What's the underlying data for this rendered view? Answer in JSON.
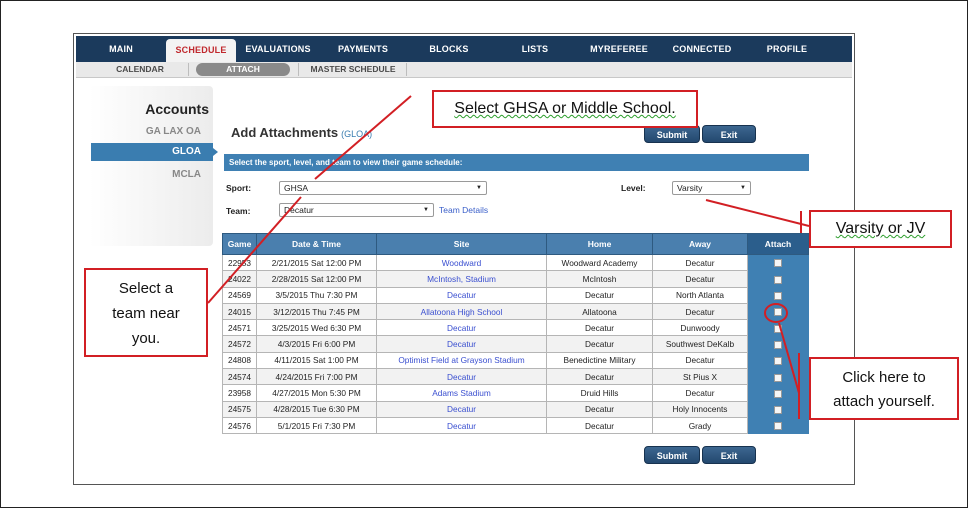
{
  "nav": {
    "items": [
      "MAIN",
      "SCHEDULE",
      "EVALUATIONS",
      "PAYMENTS",
      "BLOCKS",
      "LISTS",
      "MYREFEREE",
      "CONNECTED",
      "PROFILE"
    ],
    "active": "SCHEDULE"
  },
  "subnav": {
    "calendar": "CALENDAR",
    "attach": "ATTACH",
    "master": "MASTER SCHEDULE"
  },
  "accounts": {
    "title": "Accounts",
    "items": [
      "GA LAX OA",
      "GLOA",
      "MCLA"
    ],
    "active": "GLOA"
  },
  "page": {
    "title": "Add Attachments",
    "subtitle": "(GLOA)",
    "submit": "Submit",
    "exit": "Exit",
    "instruction": "Select the sport, level, and team to view their game schedule:"
  },
  "form": {
    "sport_label": "Sport:",
    "sport_value": "GHSA",
    "level_label": "Level:",
    "level_value": "Varsity",
    "team_label": "Team:",
    "team_value": "Decatur",
    "team_details": "Team Details"
  },
  "table": {
    "headers": [
      "Game",
      "Date & Time",
      "Site",
      "Home",
      "Away",
      "Attach"
    ],
    "rows": [
      [
        "22953",
        "2/21/2015 Sat 12:00 PM",
        "Woodward",
        "Woodward Academy",
        "Decatur"
      ],
      [
        "24022",
        "2/28/2015 Sat 12:00 PM",
        "McIntosh, Stadium",
        "McIntosh",
        "Decatur"
      ],
      [
        "24569",
        "3/5/2015 Thu 7:30 PM",
        "Decatur",
        "Decatur",
        "North Atlanta"
      ],
      [
        "24015",
        "3/12/2015 Thu 7:45 PM",
        "Allatoona High School",
        "Allatoona",
        "Decatur"
      ],
      [
        "24571",
        "3/25/2015 Wed 6:30 PM",
        "Decatur",
        "Decatur",
        "Dunwoody"
      ],
      [
        "24572",
        "4/3/2015 Fri 6:00 PM",
        "Decatur",
        "Decatur",
        "Southwest DeKalb"
      ],
      [
        "24808",
        "4/11/2015 Sat 1:00 PM",
        "Optimist Field at Grayson Stadium",
        "Benedictine Military",
        "Decatur"
      ],
      [
        "24574",
        "4/24/2015 Fri 7:00 PM",
        "Decatur",
        "Decatur",
        "St Pius X"
      ],
      [
        "23958",
        "4/27/2015 Mon 5:30 PM",
        "Adams Stadium",
        "Druid Hills",
        "Decatur"
      ],
      [
        "24575",
        "4/28/2015 Tue 6:30 PM",
        "Decatur",
        "Decatur",
        "Holy Innocents"
      ],
      [
        "24576",
        "5/1/2015 Fri 7:30 PM",
        "Decatur",
        "Decatur",
        "Grady"
      ]
    ]
  },
  "annotations": {
    "ghsa": "Select GHSA or Middle  School.",
    "varsity": "Varsity or JV",
    "team_line1": "Select a",
    "team_line2": "team near",
    "team_line3": "you.",
    "attach_line1": "Click here to",
    "attach_line2": "attach yourself."
  },
  "colors": {
    "nav": "#1b3a5c",
    "accent": "#3f80b3",
    "annotation": "#d21f24"
  }
}
